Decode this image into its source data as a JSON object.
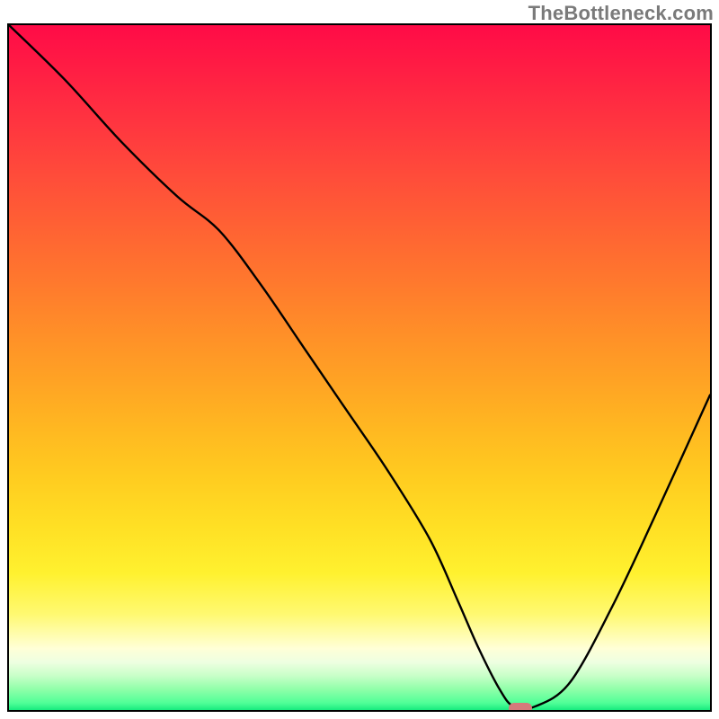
{
  "watermark": {
    "text": "TheBottleneck.com"
  },
  "chart_data": {
    "type": "line",
    "title": "",
    "xlabel": "",
    "ylabel": "",
    "xlim": [
      0,
      100
    ],
    "ylim": [
      0,
      100
    ],
    "x": [
      0,
      8,
      16,
      24,
      30,
      36,
      42,
      48,
      54,
      60,
      64,
      67,
      70,
      72,
      75,
      80,
      86,
      92,
      100
    ],
    "values": [
      100,
      92,
      83,
      75,
      70,
      62,
      53,
      44,
      35,
      25,
      16,
      9,
      3,
      0.5,
      0.5,
      4,
      15,
      28,
      46
    ],
    "marker": {
      "x": 73,
      "y": 0.2
    },
    "background": {
      "gradient_stops": [
        {
          "pos": 0,
          "color": "#ff0b47"
        },
        {
          "pos": 80,
          "color": "#fff12f"
        },
        {
          "pos": 100,
          "color": "#17ea7e"
        }
      ]
    }
  }
}
